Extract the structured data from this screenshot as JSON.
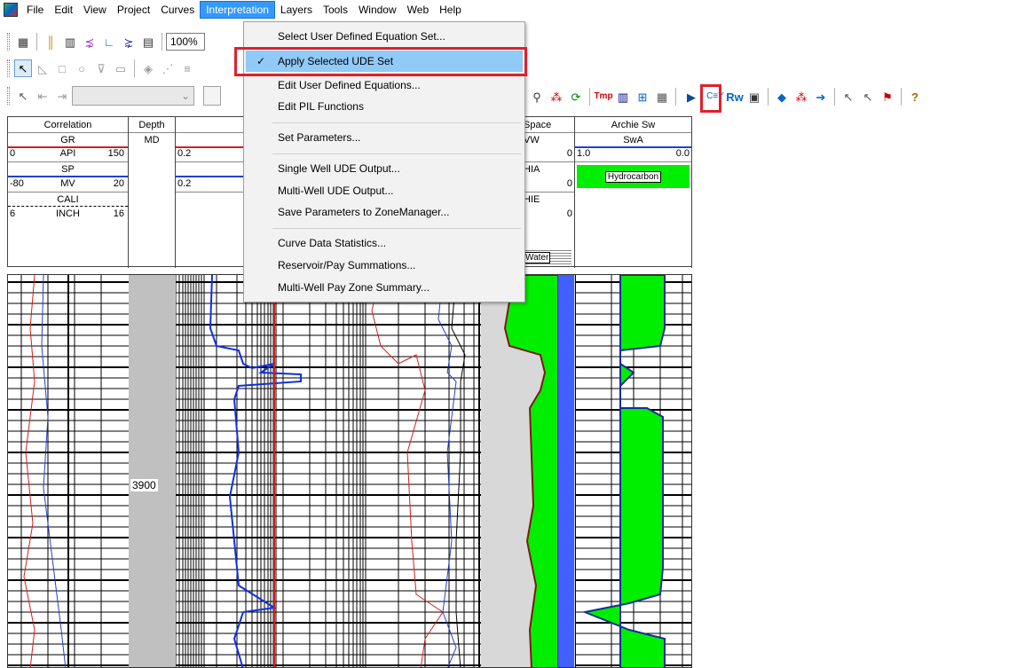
{
  "menubar": {
    "items": [
      "File",
      "Edit",
      "View",
      "Project",
      "Curves",
      "Interpretation",
      "Layers",
      "Tools",
      "Window",
      "Web",
      "Help"
    ],
    "active_index": 5
  },
  "toolbar": {
    "zoom_value": "100%"
  },
  "interpretation_menu": {
    "items": [
      {
        "label": "Select User Defined Equation Set...",
        "checked": false
      },
      {
        "label": "Apply Selected UDE Set",
        "checked": true
      },
      {
        "label": "Edit User Defined Equations...",
        "checked": false
      },
      {
        "label": "Edit PIL Functions",
        "checked": false
      },
      {
        "label": "Set Parameters...",
        "checked": false
      },
      {
        "label": "Single Well UDE Output...",
        "checked": false
      },
      {
        "label": "Multi-Well UDE Output...",
        "checked": false
      },
      {
        "label": "Save Parameters to ZoneManager...",
        "checked": false
      },
      {
        "label": "Curve Data Statistics...",
        "checked": false
      },
      {
        "label": "Reservoir/Pay Summations...",
        "checked": false
      },
      {
        "label": "Multi-Well Pay Zone Summary...",
        "checked": false
      }
    ]
  },
  "tracks": {
    "correlation": {
      "title": "Correlation",
      "curves": [
        {
          "name": "GR",
          "unit": "API",
          "min": "0",
          "max": "150",
          "color": "#d02020"
        },
        {
          "name": "SP",
          "unit": "MV",
          "min": "-80",
          "max": "20",
          "color": "#2040d0"
        },
        {
          "name": "CALI",
          "unit": "INCH",
          "min": "6",
          "max": "16",
          "color": "#000000"
        }
      ]
    },
    "depth": {
      "title": "Depth",
      "unit": "MD",
      "label": "3900"
    },
    "resistivity": {
      "scale_min": "0.2",
      "scale_min_2": "0.2"
    },
    "pore_space": {
      "title_partial": "Space",
      "l1": "VW",
      "l1_val": "0",
      "l2": "HIA",
      "l2_val": "0",
      "l3": "HIE",
      "l3_val": "0",
      "water_label": "Water"
    },
    "archie": {
      "title": "Archie Sw",
      "curve": "SwA",
      "min": "1.0",
      "max": "0.0",
      "fill_label": "Hydrocarbon"
    }
  },
  "colors": {
    "menu_active": "#3399ff",
    "menu_check_bg": "#91c9f7",
    "highlight": "#e0202c",
    "hydrocarbon": "#00ee00",
    "matrix": "#4060ff"
  }
}
